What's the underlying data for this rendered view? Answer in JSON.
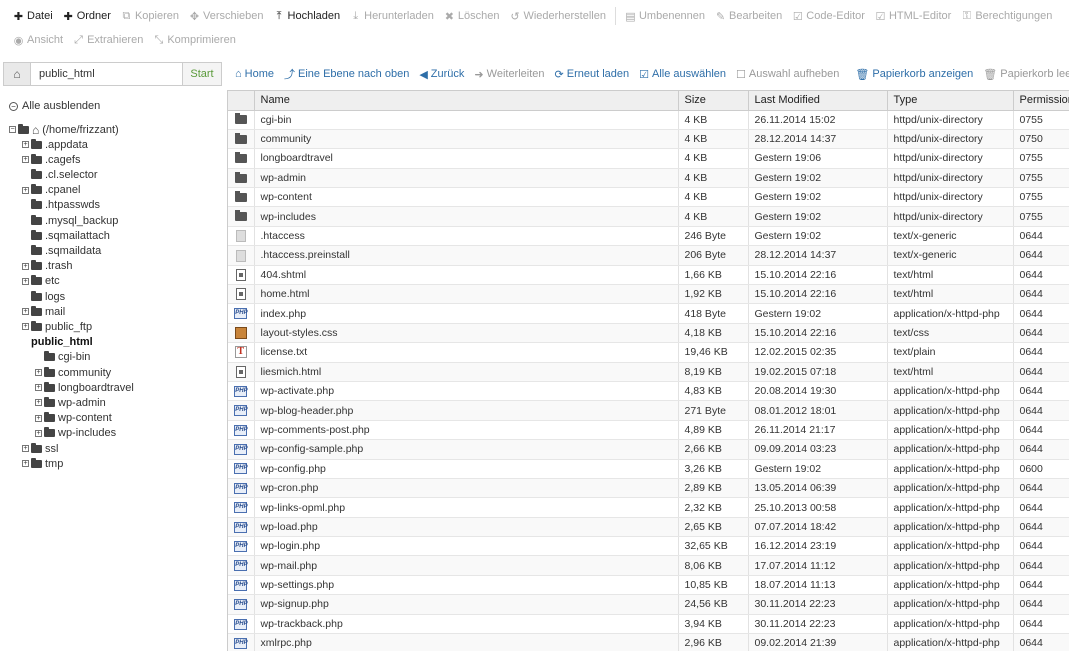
{
  "toolbar": {
    "row1": [
      {
        "label": "Datei",
        "icon": "plus-icon",
        "glyph": "✚",
        "active": true
      },
      {
        "label": "Ordner",
        "icon": "plus-icon",
        "glyph": "✚",
        "active": true
      },
      {
        "label": "Kopieren",
        "icon": "copy-icon",
        "glyph": "⧉",
        "active": false
      },
      {
        "label": "Verschieben",
        "icon": "move-icon",
        "glyph": "✥",
        "active": false
      },
      {
        "label": "Hochladen",
        "icon": "upload-icon",
        "glyph": "⤒",
        "active": true
      },
      {
        "label": "Herunterladen",
        "icon": "download-icon",
        "glyph": "⤓",
        "active": false
      },
      {
        "label": "Löschen",
        "icon": "delete-icon",
        "glyph": "✖",
        "active": false
      },
      {
        "label": "Wiederherstellen",
        "icon": "restore-icon",
        "glyph": "↺",
        "active": false
      },
      {
        "label": "Umbenennen",
        "icon": "rename-icon",
        "glyph": "▤",
        "active": false
      },
      {
        "label": "Bearbeiten",
        "icon": "edit-icon",
        "glyph": "✎",
        "active": false
      },
      {
        "label": "Code-Editor",
        "icon": "code-editor-icon",
        "glyph": "☑",
        "active": false
      },
      {
        "label": "HTML-Editor",
        "icon": "html-editor-icon",
        "glyph": "☑",
        "active": false
      },
      {
        "label": "Berechtigungen",
        "icon": "key-icon",
        "glyph": "⚿",
        "active": false
      }
    ],
    "row2": [
      {
        "label": "Ansicht",
        "icon": "eye-icon",
        "glyph": "◉",
        "active": false
      },
      {
        "label": "Extrahieren",
        "icon": "extract-icon",
        "glyph": "⤢",
        "active": false
      },
      {
        "label": "Komprimieren",
        "icon": "compress-icon",
        "glyph": "⤡",
        "active": false
      }
    ]
  },
  "pathbar": {
    "path": "public_html",
    "go_label": "Start"
  },
  "navbar": [
    {
      "label": "Home",
      "icon": "home-icon",
      "glyph": "⌂",
      "enabled": true
    },
    {
      "label": "Eine Ebene nach oben",
      "icon": "level-up-icon",
      "glyph": "⤴",
      "enabled": true
    },
    {
      "label": "Zurück",
      "icon": "arrow-left-icon",
      "glyph": "◀",
      "enabled": true
    },
    {
      "label": "Weiterleiten",
      "icon": "arrow-right-icon",
      "glyph": "➜",
      "enabled": false
    },
    {
      "label": "Erneut laden",
      "icon": "refresh-icon",
      "glyph": "⟳",
      "enabled": true
    },
    {
      "label": "Alle auswählen",
      "icon": "check-square-icon",
      "glyph": "☑",
      "enabled": true
    },
    {
      "label": "Auswahl aufheben",
      "icon": "square-icon",
      "glyph": "☐",
      "enabled": false
    },
    {
      "label": "Papierkorb anzeigen",
      "icon": "trash-icon",
      "glyph": "🗑",
      "enabled": true
    },
    {
      "label": "Papierkorb leeren",
      "icon": "trash-icon",
      "glyph": "🗑",
      "enabled": false
    }
  ],
  "tree": {
    "collapse_all": "Alle ausblenden",
    "root": "(/home/frizzant)",
    "nodes": [
      {
        "label": ".appdata",
        "level": 1,
        "expandable": true
      },
      {
        "label": ".cagefs",
        "level": 1,
        "expandable": true
      },
      {
        "label": ".cl.selector",
        "level": 1,
        "expandable": false
      },
      {
        "label": ".cpanel",
        "level": 1,
        "expandable": true
      },
      {
        "label": ".htpasswds",
        "level": 1,
        "expandable": false
      },
      {
        "label": ".mysql_backup",
        "level": 1,
        "expandable": false
      },
      {
        "label": ".sqmailattach",
        "level": 1,
        "expandable": false
      },
      {
        "label": ".sqmaildata",
        "level": 1,
        "expandable": false
      },
      {
        "label": ".trash",
        "level": 1,
        "expandable": true
      },
      {
        "label": "etc",
        "level": 1,
        "expandable": true
      },
      {
        "label": "logs",
        "level": 1,
        "expandable": false
      },
      {
        "label": "mail",
        "level": 1,
        "expandable": true
      },
      {
        "label": "public_ftp",
        "level": 1,
        "expandable": true
      },
      {
        "label": "public_html",
        "level": 1,
        "expandable": false,
        "selected": true
      },
      {
        "label": "cgi-bin",
        "level": 2,
        "expandable": false
      },
      {
        "label": "community",
        "level": 2,
        "expandable": true
      },
      {
        "label": "longboardtravel",
        "level": 2,
        "expandable": true
      },
      {
        "label": "wp-admin",
        "level": 2,
        "expandable": true
      },
      {
        "label": "wp-content",
        "level": 2,
        "expandable": true
      },
      {
        "label": "wp-includes",
        "level": 2,
        "expandable": true
      },
      {
        "label": "ssl",
        "level": 1,
        "expandable": true
      },
      {
        "label": "tmp",
        "level": 1,
        "expandable": true
      }
    ]
  },
  "table": {
    "headers": [
      "Name",
      "Size",
      "Last Modified",
      "Type",
      "Permission"
    ],
    "rows": [
      {
        "icon": "folder",
        "name": "cgi-bin",
        "size": "4 KB",
        "modified": "26.11.2014 15:02",
        "type": "httpd/unix-directory",
        "perm": "0755"
      },
      {
        "icon": "folder",
        "name": "community",
        "size": "4 KB",
        "modified": "28.12.2014 14:37",
        "type": "httpd/unix-directory",
        "perm": "0750"
      },
      {
        "icon": "folder",
        "name": "longboardtravel",
        "size": "4 KB",
        "modified": "Gestern 19:06",
        "type": "httpd/unix-directory",
        "perm": "0755"
      },
      {
        "icon": "folder",
        "name": "wp-admin",
        "size": "4 KB",
        "modified": "Gestern 19:02",
        "type": "httpd/unix-directory",
        "perm": "0755"
      },
      {
        "icon": "folder",
        "name": "wp-content",
        "size": "4 KB",
        "modified": "Gestern 19:02",
        "type": "httpd/unix-directory",
        "perm": "0755"
      },
      {
        "icon": "folder",
        "name": "wp-includes",
        "size": "4 KB",
        "modified": "Gestern 19:02",
        "type": "httpd/unix-directory",
        "perm": "0755"
      },
      {
        "icon": "generic",
        "name": ".htaccess",
        "size": "246 Byte",
        "modified": "Gestern 19:02",
        "type": "text/x-generic",
        "perm": "0644"
      },
      {
        "icon": "generic",
        "name": ".htaccess.preinstall",
        "size": "206 Byte",
        "modified": "28.12.2014 14:37",
        "type": "text/x-generic",
        "perm": "0644"
      },
      {
        "icon": "html",
        "name": "404.shtml",
        "size": "1,66 KB",
        "modified": "15.10.2014 22:16",
        "type": "text/html",
        "perm": "0644"
      },
      {
        "icon": "html",
        "name": "home.html",
        "size": "1,92 KB",
        "modified": "15.10.2014 22:16",
        "type": "text/html",
        "perm": "0644"
      },
      {
        "icon": "php",
        "name": "index.php",
        "size": "418 Byte",
        "modified": "Gestern 19:02",
        "type": "application/x-httpd-php",
        "perm": "0644"
      },
      {
        "icon": "css",
        "name": "layout-styles.css",
        "size": "4,18 KB",
        "modified": "15.10.2014 22:16",
        "type": "text/css",
        "perm": "0644"
      },
      {
        "icon": "txt",
        "name": "license.txt",
        "size": "19,46 KB",
        "modified": "12.02.2015 02:35",
        "type": "text/plain",
        "perm": "0644"
      },
      {
        "icon": "html",
        "name": "liesmich.html",
        "size": "8,19 KB",
        "modified": "19.02.2015 07:18",
        "type": "text/html",
        "perm": "0644"
      },
      {
        "icon": "php",
        "name": "wp-activate.php",
        "size": "4,83 KB",
        "modified": "20.08.2014 19:30",
        "type": "application/x-httpd-php",
        "perm": "0644"
      },
      {
        "icon": "php",
        "name": "wp-blog-header.php",
        "size": "271 Byte",
        "modified": "08.01.2012 18:01",
        "type": "application/x-httpd-php",
        "perm": "0644"
      },
      {
        "icon": "php",
        "name": "wp-comments-post.php",
        "size": "4,89 KB",
        "modified": "26.11.2014 21:17",
        "type": "application/x-httpd-php",
        "perm": "0644"
      },
      {
        "icon": "php",
        "name": "wp-config-sample.php",
        "size": "2,66 KB",
        "modified": "09.09.2014 03:23",
        "type": "application/x-httpd-php",
        "perm": "0644"
      },
      {
        "icon": "php",
        "name": "wp-config.php",
        "size": "3,26 KB",
        "modified": "Gestern 19:02",
        "type": "application/x-httpd-php",
        "perm": "0600"
      },
      {
        "icon": "php",
        "name": "wp-cron.php",
        "size": "2,89 KB",
        "modified": "13.05.2014 06:39",
        "type": "application/x-httpd-php",
        "perm": "0644"
      },
      {
        "icon": "php",
        "name": "wp-links-opml.php",
        "size": "2,32 KB",
        "modified": "25.10.2013 00:58",
        "type": "application/x-httpd-php",
        "perm": "0644"
      },
      {
        "icon": "php",
        "name": "wp-load.php",
        "size": "2,65 KB",
        "modified": "07.07.2014 18:42",
        "type": "application/x-httpd-php",
        "perm": "0644"
      },
      {
        "icon": "php",
        "name": "wp-login.php",
        "size": "32,65 KB",
        "modified": "16.12.2014 23:19",
        "type": "application/x-httpd-php",
        "perm": "0644"
      },
      {
        "icon": "php",
        "name": "wp-mail.php",
        "size": "8,06 KB",
        "modified": "17.07.2014 11:12",
        "type": "application/x-httpd-php",
        "perm": "0644"
      },
      {
        "icon": "php",
        "name": "wp-settings.php",
        "size": "10,85 KB",
        "modified": "18.07.2014 11:13",
        "type": "application/x-httpd-php",
        "perm": "0644"
      },
      {
        "icon": "php",
        "name": "wp-signup.php",
        "size": "24,56 KB",
        "modified": "30.11.2014 22:23",
        "type": "application/x-httpd-php",
        "perm": "0644"
      },
      {
        "icon": "php",
        "name": "wp-trackback.php",
        "size": "3,94 KB",
        "modified": "30.11.2014 22:23",
        "type": "application/x-httpd-php",
        "perm": "0644"
      },
      {
        "icon": "php",
        "name": "xmlrpc.php",
        "size": "2,96 KB",
        "modified": "09.02.2014 21:39",
        "type": "application/x-httpd-php",
        "perm": "0644"
      }
    ]
  },
  "colors": {
    "link": "#2e6ea8",
    "disabled": "#aaaaaa",
    "header_bg": "#efefef",
    "start_green": "#5a9a3a"
  }
}
